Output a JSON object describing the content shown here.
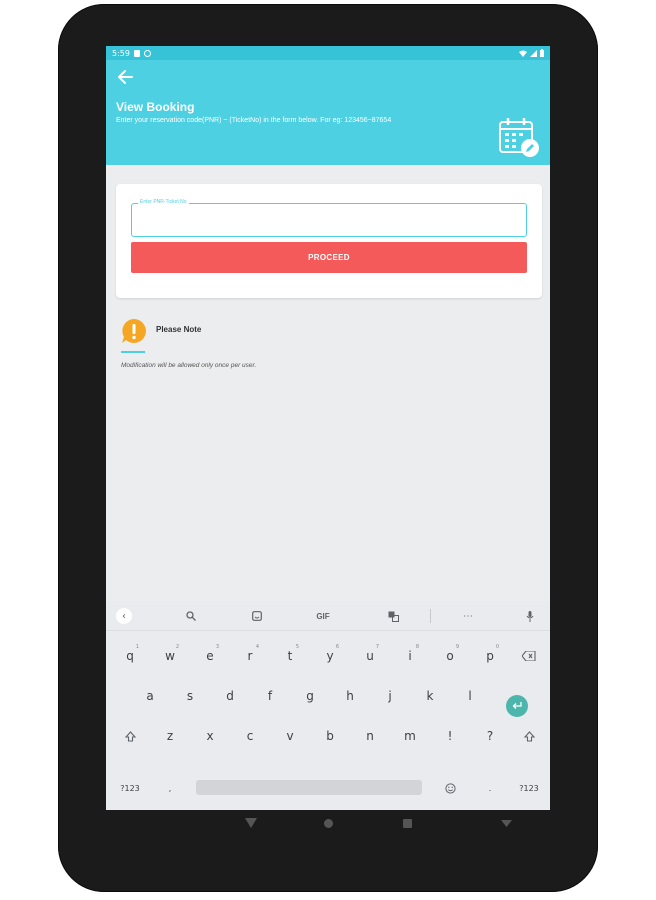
{
  "status_bar": {
    "time": "5:59"
  },
  "app_bar": {
    "title": "View Booking",
    "subtitle": "Enter your reservation code(PNR) ~ (TicketNo) in the form below. For eg: 123456~87654",
    "accent_color": "#4dd0e1"
  },
  "form": {
    "pnr_field_label": "Enter PNR-Ticket No",
    "pnr_field_value": "",
    "proceed_label": "PROCEED",
    "button_color": "#f55a5a"
  },
  "note": {
    "title": "Please Note",
    "text": "Modification will be allowed only once per user.",
    "icon": "warning-icon",
    "icon_color": "#f5a623"
  },
  "keyboard": {
    "toolbar": [
      "collapse-icon",
      "search-icon",
      "sticker-icon",
      "GIF",
      "translate-icon",
      "more-icon",
      "mic-icon"
    ],
    "gif_label": "GIF",
    "row1": [
      {
        "k": "q",
        "s": "1"
      },
      {
        "k": "w",
        "s": "2"
      },
      {
        "k": "e",
        "s": "3"
      },
      {
        "k": "r",
        "s": "4"
      },
      {
        "k": "t",
        "s": "5"
      },
      {
        "k": "y",
        "s": "6"
      },
      {
        "k": "u",
        "s": "7"
      },
      {
        "k": "i",
        "s": "8"
      },
      {
        "k": "o",
        "s": "9"
      },
      {
        "k": "p",
        "s": "0"
      }
    ],
    "row2": [
      "a",
      "s",
      "d",
      "f",
      "g",
      "h",
      "j",
      "k",
      "l"
    ],
    "row3": [
      "z",
      "x",
      "c",
      "v",
      "b",
      "n",
      "m",
      "!",
      "?"
    ],
    "symbols_label": "?123",
    "comma": ",",
    "period": "."
  }
}
